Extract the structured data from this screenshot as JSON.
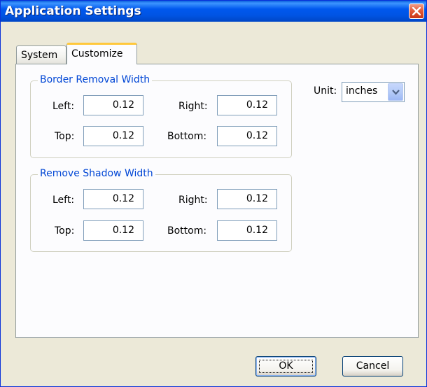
{
  "window": {
    "title": "Application Settings"
  },
  "tabs": [
    {
      "label": "System",
      "selected": false
    },
    {
      "label": "Customize",
      "selected": true
    }
  ],
  "border_removal": {
    "legend": "Border Removal Width",
    "left_label": "Left:",
    "left_value": "0.12",
    "right_label": "Right:",
    "right_value": "0.12",
    "top_label": "Top:",
    "top_value": "0.12",
    "bottom_label": "Bottom:",
    "bottom_value": "0.12"
  },
  "shadow": {
    "legend": "Remove Shadow Width",
    "left_label": "Left:",
    "left_value": "0.12",
    "right_label": "Right:",
    "right_value": "0.12",
    "top_label": "Top:",
    "top_value": "0.12",
    "bottom_label": "Bottom:",
    "bottom_value": "0.12"
  },
  "unit": {
    "label": "Unit:",
    "value": "inches"
  },
  "buttons": {
    "ok": "OK",
    "cancel": "Cancel"
  },
  "colors": {
    "titlebar": "#0054e3",
    "legend": "#0046d5",
    "tab_accent": "#ffc83c"
  },
  "icons": {
    "close": "close-icon",
    "dropdown": "chevron-down-icon"
  }
}
